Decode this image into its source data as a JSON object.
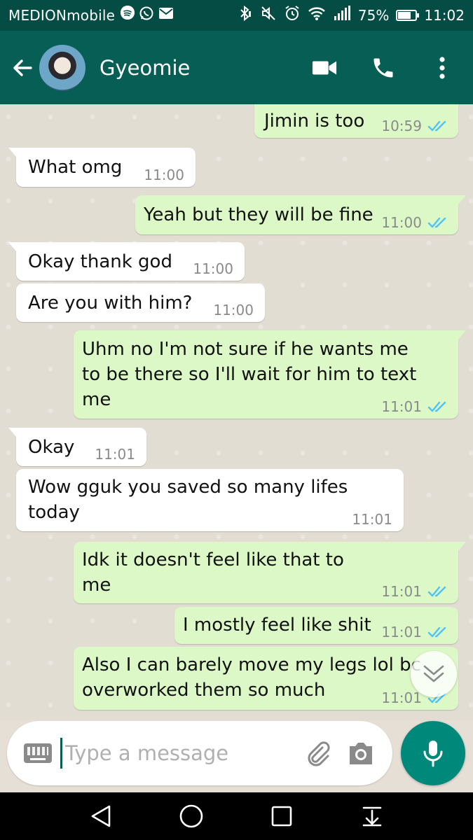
{
  "status_bar": {
    "carrier": "MEDIONmobile",
    "battery_percent": "75%",
    "battery_level": 0.75,
    "time": "11:02",
    "icons": [
      "spotify-icon",
      "whatsapp-icon",
      "mail-icon",
      "bluetooth-icon",
      "mute-icon",
      "alarm-icon",
      "wifi-icon",
      "signal-icon",
      "battery-icon"
    ]
  },
  "header": {
    "contact_name": "Gyeomie",
    "icons": [
      "back-arrow-icon",
      "video-call-icon",
      "phone-call-icon",
      "more-options-icon"
    ]
  },
  "messages": [
    {
      "direction": "out",
      "text": "Jimin is too",
      "time": "10:59",
      "status": "read"
    },
    {
      "direction": "in",
      "text": "What omg",
      "time": "11:00"
    },
    {
      "direction": "out",
      "text": "Yeah but they will be fine",
      "time": "11:00",
      "status": "read"
    },
    {
      "direction": "in",
      "text": "Okay thank god",
      "time": "11:00"
    },
    {
      "direction": "in",
      "text": "Are you with him?",
      "time": "11:00"
    },
    {
      "direction": "out",
      "text": "Uhm no I'm not sure if he wants me to be there so I'll wait for him to text me",
      "time": "11:01",
      "status": "read"
    },
    {
      "direction": "in",
      "text": "Okay",
      "time": "11:01"
    },
    {
      "direction": "in",
      "text": "Wow gguk you saved so many lifes today",
      "time": "11:01"
    },
    {
      "direction": "out",
      "text": "Idk it doesn't feel like that to me",
      "time": "11:01",
      "status": "read"
    },
    {
      "direction": "out",
      "text": "I mostly feel like shit",
      "time": "11:01",
      "status": "read"
    },
    {
      "direction": "out",
      "text": "Also I can barely move my legs lol bc overworked them so much",
      "time": "11:01",
      "status": "read"
    }
  ],
  "composer": {
    "placeholder": "Type a message",
    "value": ""
  },
  "colors": {
    "status_bar": "#054d44",
    "app_bar": "#075e54",
    "outgoing_bubble": "#dcf8c6",
    "incoming_bubble": "#ffffff",
    "read_tick": "#4fc3f7",
    "mic_button": "#00897b"
  }
}
